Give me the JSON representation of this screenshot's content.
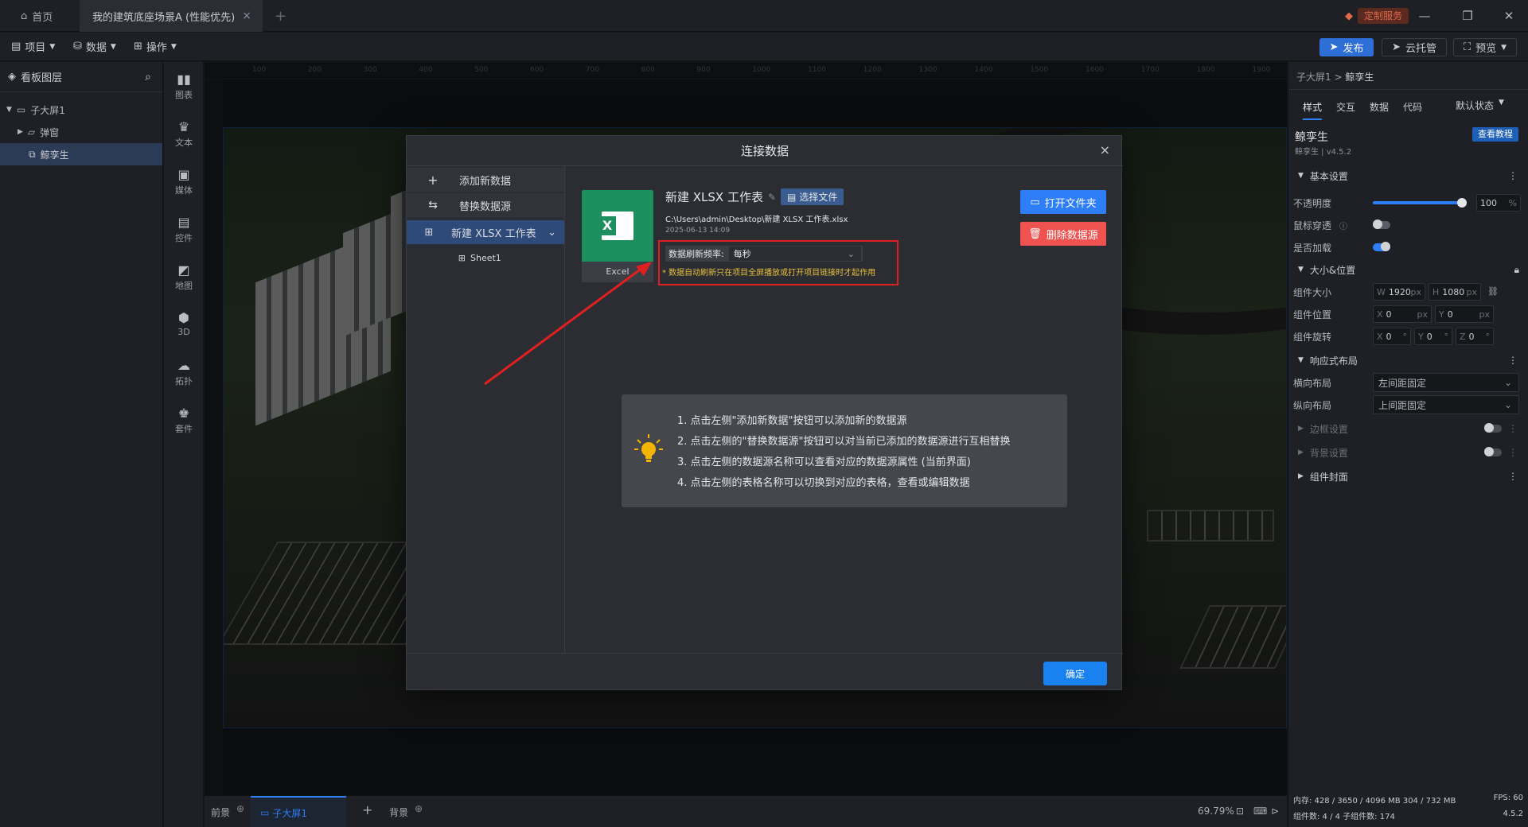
{
  "titlebar": {
    "home_tab": "首页",
    "project_tab": "我的建筑底座场景A (性能优先)",
    "close_glyph": "×",
    "add_tab_glyph": "+",
    "custom_service": "定制服务"
  },
  "menubar": {
    "project": "项目",
    "data": "数据",
    "operate": "操作",
    "publish": "发布",
    "cloud": "云托管",
    "preview": "预览"
  },
  "layers": {
    "title": "看板图层",
    "items": [
      "子大屏1",
      "弹窗",
      "鲸孪生"
    ]
  },
  "tools": [
    "图表",
    "文本",
    "媒体",
    "控件",
    "地图",
    "3D",
    "拓扑",
    "套件"
  ],
  "ruler_top": [
    "100",
    "200",
    "300",
    "400",
    "500",
    "600",
    "700",
    "800",
    "900",
    "1000",
    "1100",
    "1200",
    "1300",
    "1400",
    "1500",
    "1600",
    "1700",
    "1800",
    "1900"
  ],
  "bottombar": {
    "front": "前景",
    "screen": "子大屏1",
    "back": "背景",
    "zoom": "69.79%"
  },
  "rightpanel": {
    "breadcrumb_root": "子大屏1",
    "breadcrumb_sep": ">",
    "breadcrumb_leaf": "鲸孪生",
    "tabs": [
      "样式",
      "交互",
      "数据",
      "代码"
    ],
    "state": "默认状态",
    "component_name": "鲸孪生",
    "component_ver": "鲸孪生 | v4.5.2",
    "tutorial": "查看教程",
    "sec_basic": "基本设置",
    "opacity_label": "不透明度",
    "opacity_value": "100",
    "opacity_unit": "%",
    "opacity_fraction": 1.0,
    "mouse_label": "鼠标穿透",
    "preload_label": "是否加载",
    "sec_size": "大小&位置",
    "size_label": "组件大小",
    "w_prefix": "W",
    "w_value": "1920",
    "h_prefix": "H",
    "h_value": "1080",
    "px": "px",
    "pos_label": "组件位置",
    "x_prefix": "X",
    "x_value": "0",
    "y_prefix": "Y",
    "y_value": "0",
    "rot_label": "组件旋转",
    "z_prefix": "Z",
    "z_value": "0",
    "deg": "°",
    "sec_responsive": "响应式布局",
    "h_layout_label": "横向布局",
    "h_layout_value": "左间距固定",
    "v_layout_label": "纵向布局",
    "v_layout_value": "上间距固定",
    "sec_border": "边框设置",
    "sec_bg": "背景设置",
    "sec_cover": "组件封面",
    "memory": "内存: 428 / 3650 / 4096 MB  304 / 732 MB",
    "fps": "FPS: 60",
    "count": "组件数: 4 / 4    子组件数: 174",
    "version": "4.5.2"
  },
  "modal": {
    "title": "连接数据",
    "close": "×",
    "add_data": "添加新数据",
    "replace_data": "替换数据源",
    "source_name": "新建 XLSX 工作表",
    "sheet": "Sheet1",
    "file_title": "新建 XLSX 工作表",
    "select_file": "选择文件",
    "file_path": "C:\\Users\\admin\\Desktop\\新建 XLSX 工作表.xlsx",
    "file_date": "2025-06-13 14:09",
    "excel_label": "Excel",
    "refresh_label": "数据刷新频率:",
    "refresh_value": "每秒",
    "refresh_note": "* 数据自动刷新只在项目全屏播放或打开项目链接时才起作用",
    "open_folder": "打开文件夹",
    "delete_source": "删除数据源",
    "tips": [
      "1. 点击左侧\"添加新数据\"按钮可以添加新的数据源",
      "2. 点击左侧的\"替换数据源\"按钮可以对当前已添加的数据源进行互相替换",
      "3. 点击左侧的数据源名称可以查看对应的数据源属性 (当前界面)",
      "4. 点击左侧的表格名称可以切换到对应的表格，查看或编辑数据"
    ],
    "confirm": "确定"
  },
  "colors": {
    "accent": "#2d7ef7",
    "danger": "#ef5350",
    "excel": "#1d8f5e",
    "highlight": "#e02020"
  }
}
